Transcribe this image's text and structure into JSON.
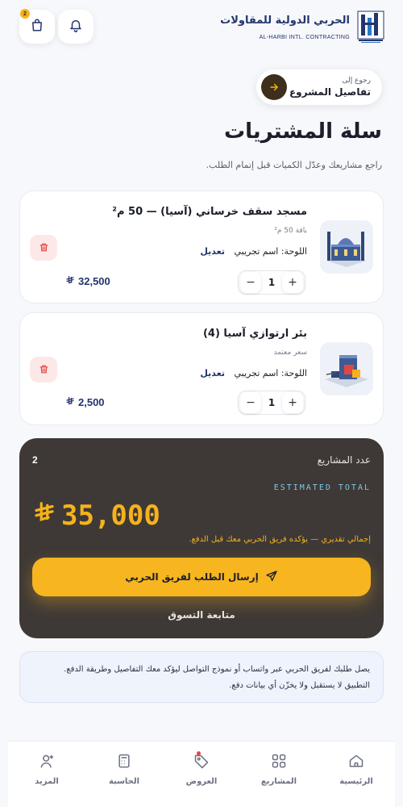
{
  "header": {
    "brand_ar": "الحربي الدولية للمقاولات",
    "brand_en": "AL-HARBI INTL. CONTRACTING",
    "cart_count": "2"
  },
  "back": {
    "small": "رجوع إلى",
    "big": "تفاصيل المشروع"
  },
  "page": {
    "title": "سلة المشتريات",
    "subtitle": "راجع مشاريعك وعدّل الكميات قبل إتمام الطلب."
  },
  "items": [
    {
      "title": "مسجد سقف خرساني (آسيا) — 50 م²",
      "meta": "باقة 50 م²",
      "board_label": "اللوحة: اسم تجريبي",
      "edit_label": "تعديل",
      "qty": "1",
      "minus": "−",
      "plus": "+",
      "price": "32,500"
    },
    {
      "title": "بئر ارتوازي آسيا (4)",
      "meta": "سعر معتمد",
      "board_label": "اللوحة: اسم تجريبي",
      "edit_label": "تعديل",
      "qty": "1",
      "minus": "−",
      "plus": "+",
      "price": "2,500"
    }
  ],
  "summary": {
    "count_label": "عدد المشاريع",
    "count": "2",
    "estimated_label": "ESTIMATED TOTAL",
    "total": "35,000",
    "note": "إجمالي تقديري — يؤكده فريق الحربي معك قبل الدفع.",
    "send_label": "إرسال الطلب لفريق الحربي",
    "continue_label": "متابعة التسوق"
  },
  "info": {
    "line1": "يصل طلبك لفريق الحربي عبر واتساب أو نموذج التواصل ليؤكد معك التفاصيل وطريقة الدفع.",
    "line2": "التطبيق لا يستقبل ولا يخزّن أي بيانات دفع."
  },
  "nav": [
    {
      "label": "الرئيسية",
      "icon": "home-icon"
    },
    {
      "label": "المشاريع",
      "icon": "grid-icon"
    },
    {
      "label": "العروض",
      "icon": "tag-icon"
    },
    {
      "label": "الحاسبة",
      "icon": "calculator-icon"
    },
    {
      "label": "المزيد",
      "icon": "user-icon"
    }
  ],
  "colors": {
    "brand": "#22356e",
    "accent": "#f7b51f",
    "summary_bg": "#3e3936",
    "danger": "#e24646"
  }
}
